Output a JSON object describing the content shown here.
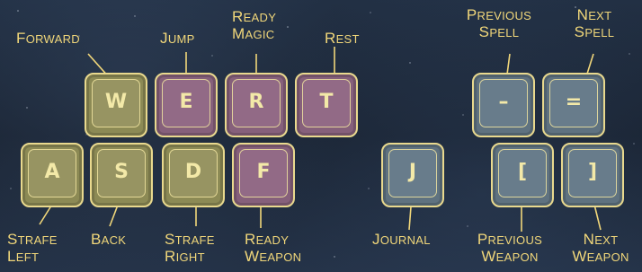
{
  "keys": {
    "w": "W",
    "e": "E",
    "r": "R",
    "t": "T",
    "a": "A",
    "s": "S",
    "d": "D",
    "f": "F",
    "j": "J",
    "minus": "–",
    "equals": "=",
    "lbracket": "[",
    "rbracket": "]"
  },
  "labels": {
    "forward": "Forward",
    "jump": "Jump",
    "ready_magic_1": "Ready",
    "ready_magic_2": "Magic",
    "rest": "Rest",
    "previous_spell_1": "Previous",
    "previous_spell_2": "Spell",
    "next_spell_1": "Next",
    "next_spell_2": "Spell",
    "strafe_left_1": "Strafe",
    "strafe_left_2": "Left",
    "back": "Back",
    "strafe_right_1": "Strafe",
    "strafe_right_2": "Right",
    "ready_weapon_1": "Ready",
    "ready_weapon_2": "Weapon",
    "journal": "Journal",
    "previous_weapon_1": "Previous",
    "previous_weapon_2": "Weapon",
    "next_weapon_1": "Next",
    "next_weapon_2": "Weapon"
  },
  "colors": {
    "movement_keys": "#8c8a55",
    "action_keys": "#86607b",
    "menu_keys": "#5f7280",
    "label_text": "#f1d77a",
    "key_border": "#e9d98e"
  }
}
